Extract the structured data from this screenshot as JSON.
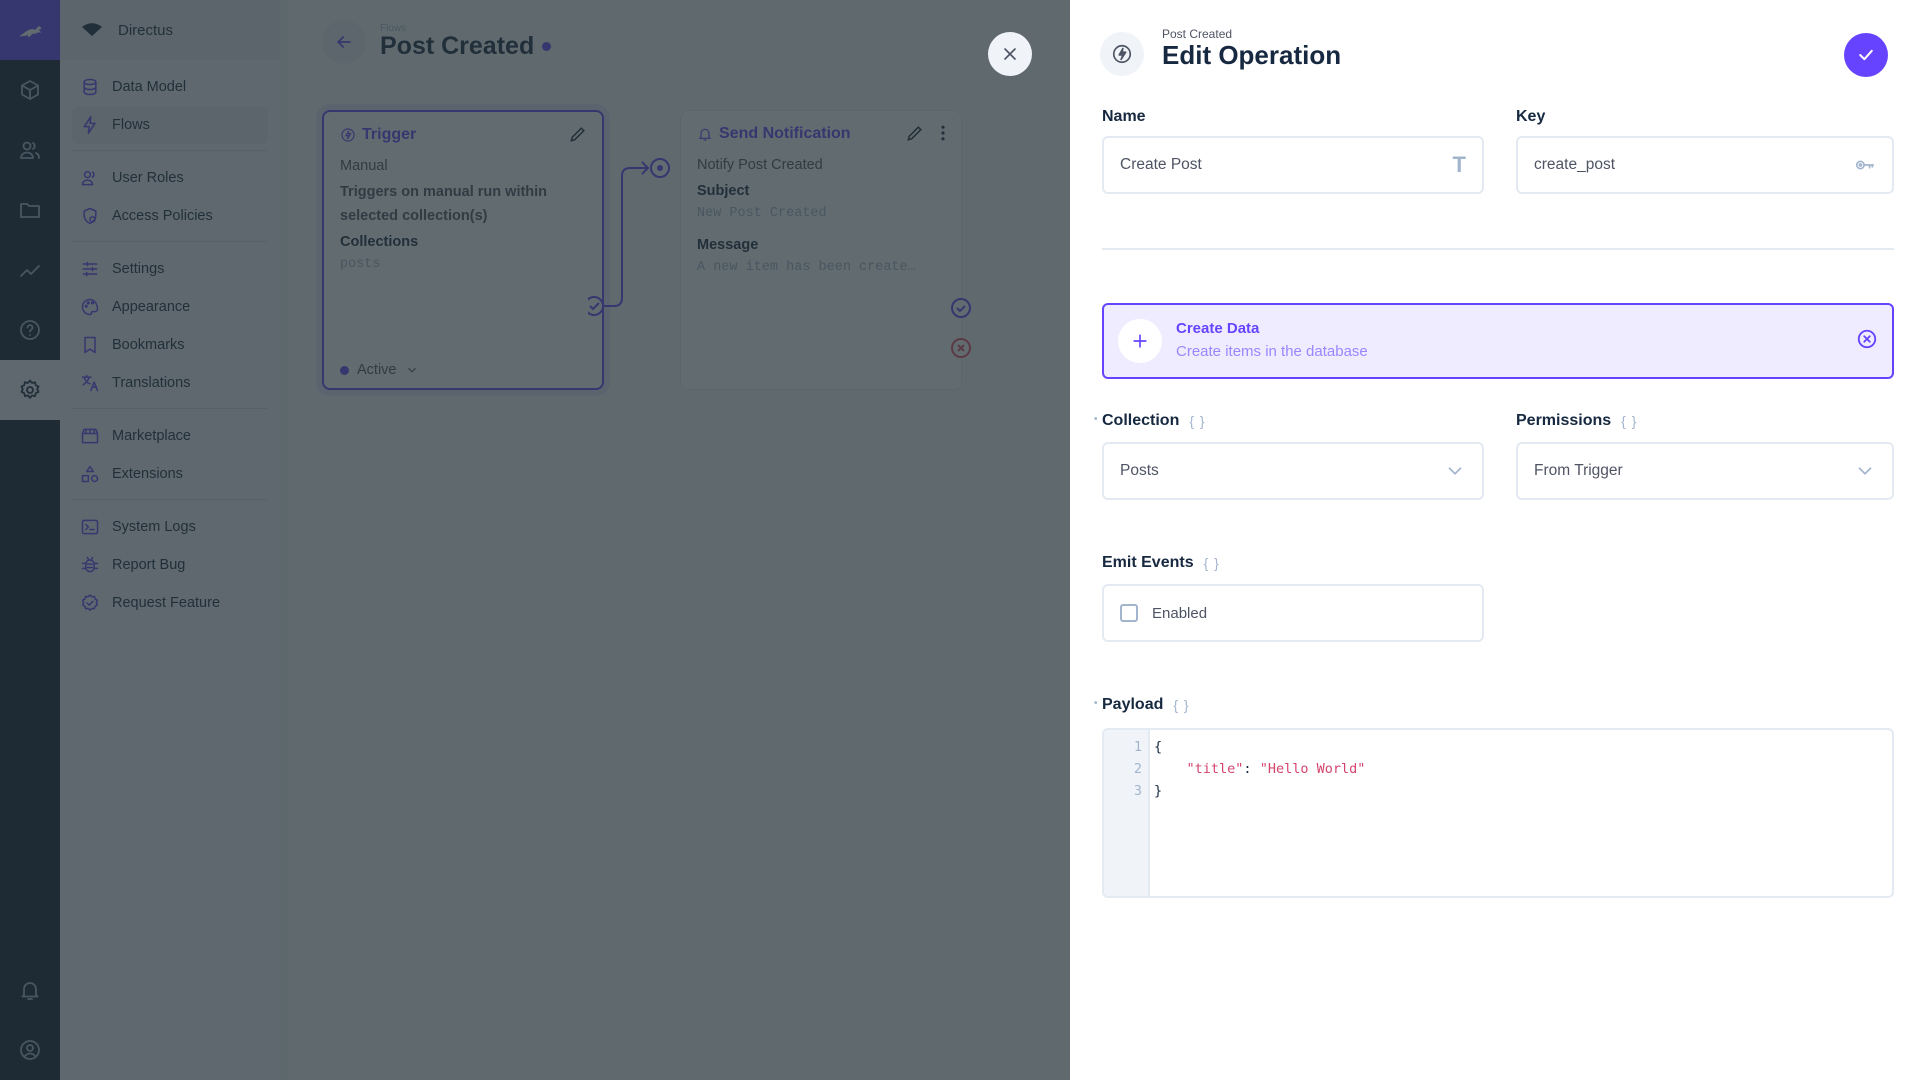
{
  "app": {
    "project_name": "Directus",
    "rail_icons": [
      "content-icon",
      "users-icon",
      "files-icon",
      "insights-icon",
      "help-icon",
      "settings-icon",
      "notifications-icon",
      "profile-icon"
    ],
    "nav_groups": [
      [
        {
          "label": "Data Model",
          "icon": "database-icon"
        },
        {
          "label": "Flows",
          "icon": "bolt-icon",
          "active": true
        }
      ],
      [
        {
          "label": "User Roles",
          "icon": "user-roles-icon"
        },
        {
          "label": "Access Policies",
          "icon": "access-policies-icon"
        }
      ],
      [
        {
          "label": "Settings",
          "icon": "sliders-icon"
        },
        {
          "label": "Appearance",
          "icon": "palette-icon"
        },
        {
          "label": "Bookmarks",
          "icon": "bookmark-icon"
        },
        {
          "label": "Translations",
          "icon": "translate-icon"
        }
      ],
      [
        {
          "label": "Marketplace",
          "icon": "storefront-icon"
        },
        {
          "label": "Extensions",
          "icon": "extensions-icon"
        }
      ],
      [
        {
          "label": "System Logs",
          "icon": "terminal-icon"
        },
        {
          "label": "Report Bug",
          "icon": "bug-icon"
        },
        {
          "label": "Request Feature",
          "icon": "verified-icon"
        }
      ]
    ]
  },
  "flow": {
    "breadcrumb": "Flows",
    "title": "Post Created",
    "trigger_card": {
      "title": "Trigger",
      "type": "Manual",
      "description": "Triggers on manual run within selected collection(s)",
      "collections_label": "Collections",
      "collections_value": "posts",
      "status": "Active"
    },
    "notify_card": {
      "title": "Send Notification",
      "name": "Notify Post Created",
      "subject_label": "Subject",
      "subject_value": "New Post Created",
      "message_label": "Message",
      "message_value": "A new item has been create…"
    }
  },
  "drawer": {
    "breadcrumb": "Post Created",
    "title": "Edit Operation",
    "name_label": "Name",
    "name_value": "Create Post",
    "key_label": "Key",
    "key_value": "create_post",
    "operation": {
      "name": "Create Data",
      "description": "Create items in the database"
    },
    "collection_label": "Collection",
    "collection_value": "Posts",
    "permissions_label": "Permissions",
    "permissions_value": "From Trigger",
    "emit_events_label": "Emit Events",
    "emit_events_option": "Enabled",
    "emit_events_checked": false,
    "payload_label": "Payload",
    "payload_lines": [
      "{",
      "    \"title\": \"Hello World\"",
      "}"
    ],
    "raw_toggle_glyph": "{ }"
  },
  "colors": {
    "accent": "#6644ff",
    "rail_bg": "#0e1c2f",
    "code_string": "#d4456e"
  }
}
